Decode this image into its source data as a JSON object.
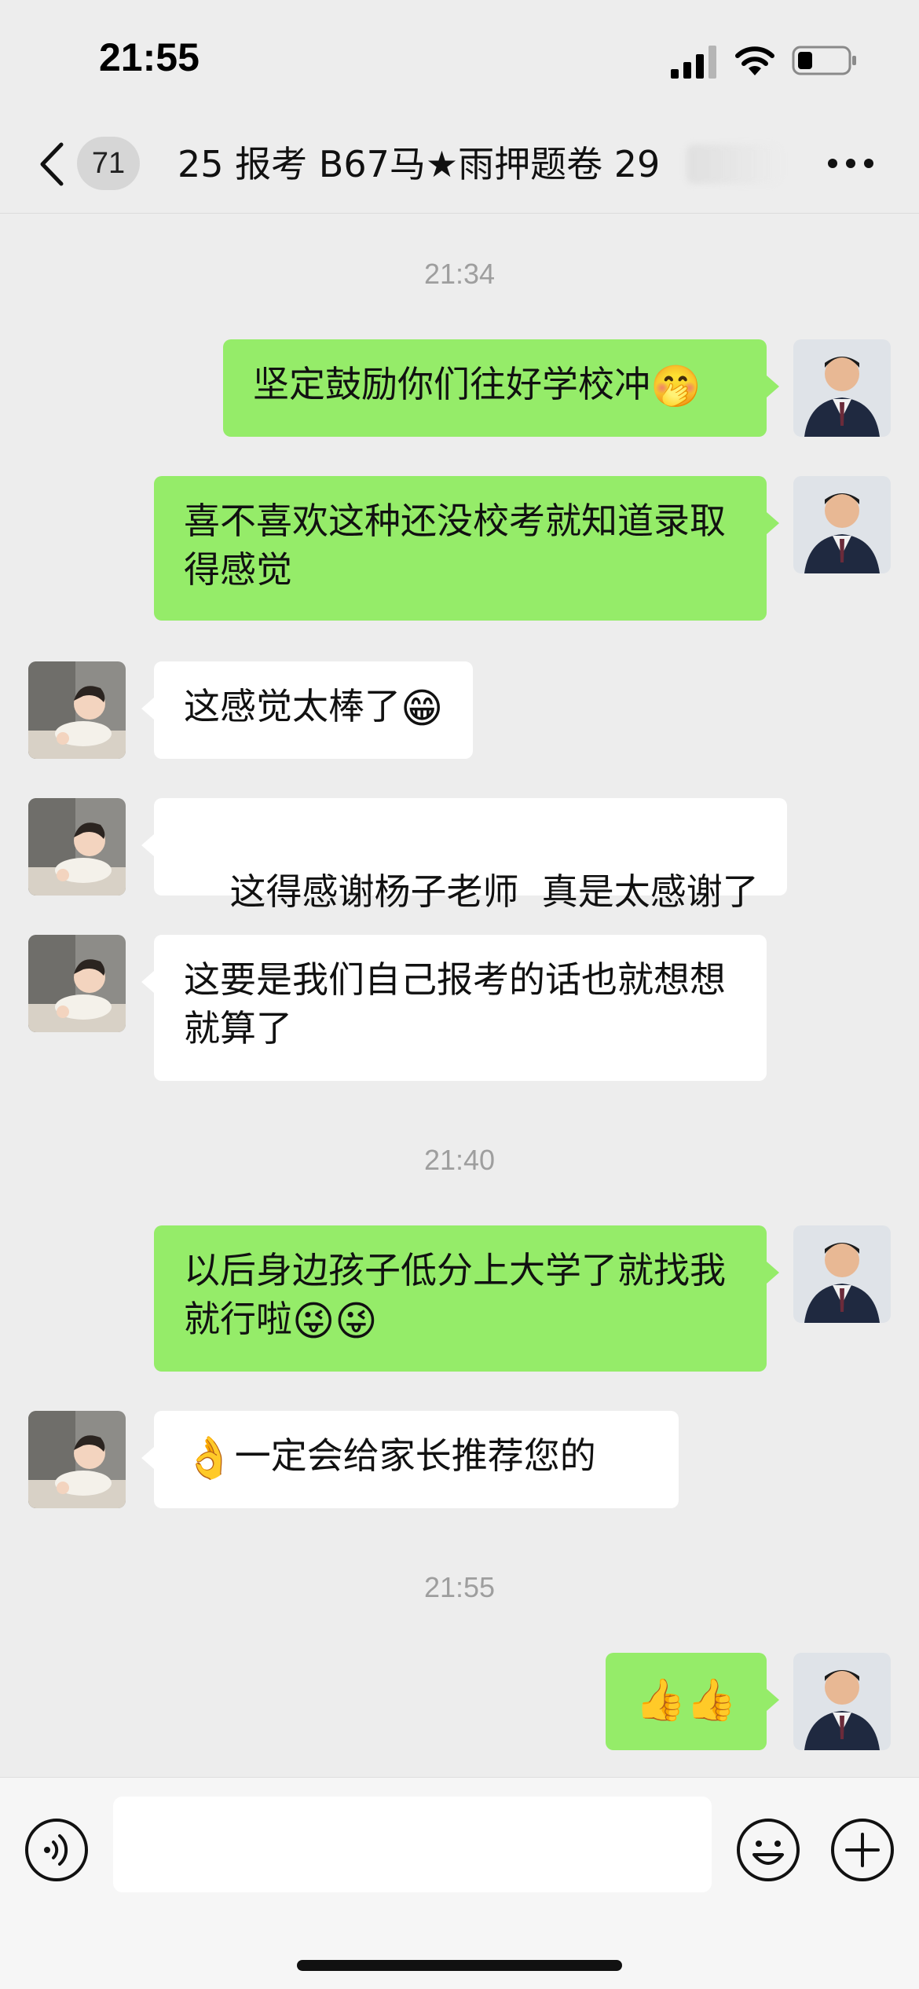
{
  "status_bar": {
    "time": "21:55"
  },
  "nav": {
    "unread_count": "71",
    "title": "25 报考 B67马★雨押题卷 29"
  },
  "messages": [
    {
      "type": "time",
      "text": "21:34"
    },
    {
      "type": "out",
      "text": "坚定鼓励你们往好学校冲",
      "emoji": "🤭"
    },
    {
      "type": "out",
      "text": "喜不喜欢这种还没校考就知道录取得感觉"
    },
    {
      "type": "in",
      "text": "这感觉太棒了",
      "emoji": "😁"
    },
    {
      "type": "in",
      "text": "这得感谢杨子老师  真是太感谢了"
    },
    {
      "type": "in",
      "text": "这要是我们自己报考的话也就想想就算了"
    },
    {
      "type": "time",
      "text": "21:40"
    },
    {
      "type": "out",
      "text": "以后身边孩子低分上大学了就找我就行啦",
      "emoji": "😜😜"
    },
    {
      "type": "in",
      "text": "一定会给家长推荐您的",
      "emoji_prefix": "👌"
    },
    {
      "type": "time",
      "text": "21:55"
    },
    {
      "type": "out",
      "text": "",
      "emoji": "👍👍"
    }
  ],
  "input": {
    "placeholder": ""
  },
  "colors": {
    "outgoing_bubble": "#95ec69",
    "incoming_bubble": "#ffffff",
    "background": "#ededed"
  },
  "icons": [
    "signal-icon",
    "wifi-icon",
    "battery-icon",
    "back-icon",
    "more-icon",
    "voice-icon",
    "emoji-icon",
    "plus-icon"
  ]
}
